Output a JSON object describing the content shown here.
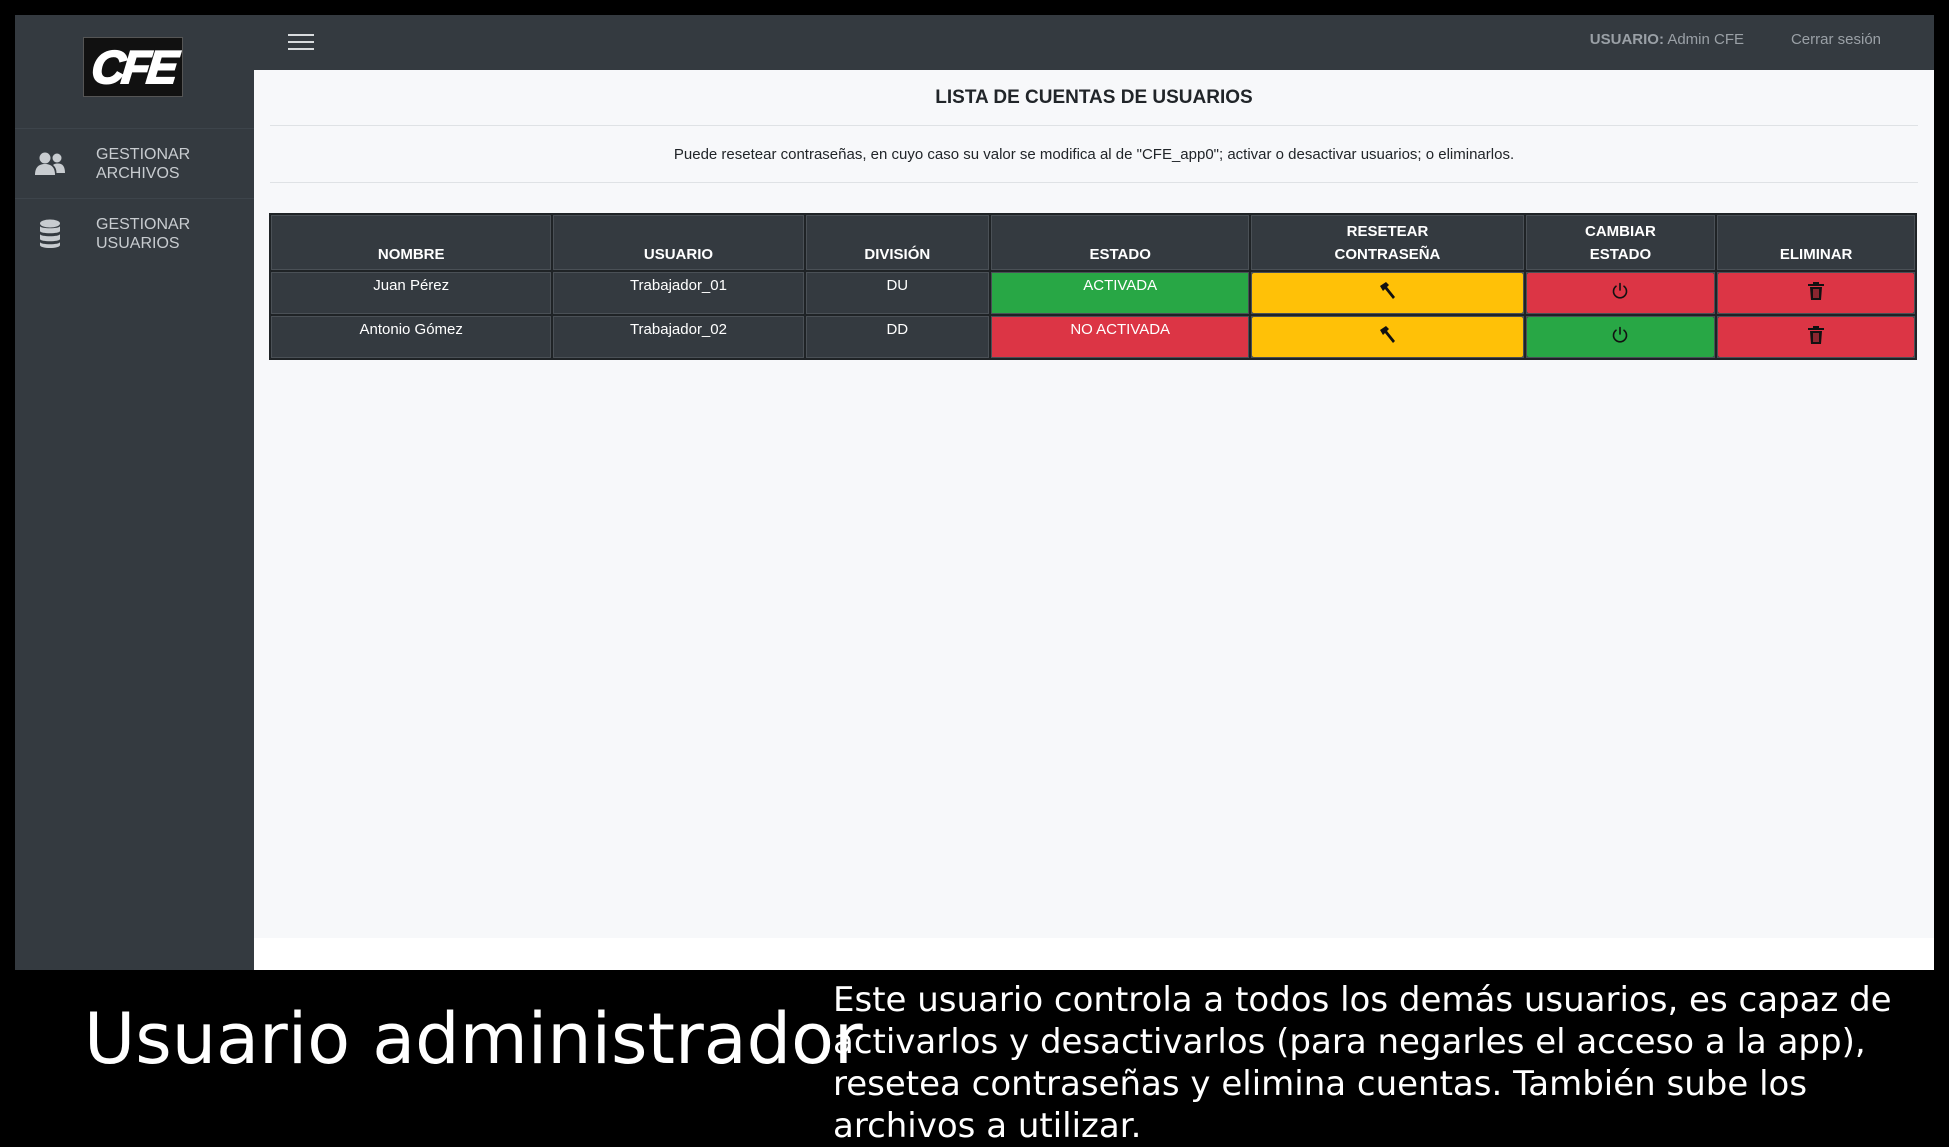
{
  "app": {
    "logo_text": "CFE",
    "user_label": "USUARIO:",
    "user_name": "Admin CFE",
    "logout_label": "Cerrar sesión"
  },
  "sidebar": {
    "items": [
      {
        "label": "GESTIONAR\nARCHIVOS",
        "icon": "users-icon"
      },
      {
        "label": "GESTIONAR\nUSUARIOS",
        "icon": "database-icon"
      }
    ]
  },
  "main": {
    "title": "LISTA DE CUENTAS DE USUARIOS",
    "description": "Puede resetear contraseñas, en cuyo caso su valor se modifica al de \"CFE_app0\"; activar o desactivar usuarios; o eliminarlos.",
    "table": {
      "headers": [
        "NOMBRE",
        "USUARIO",
        "DIVISIÓN",
        "ESTADO",
        "RESETEAR\nCONTRASEÑA",
        "CAMBIAR\nESTADO",
        "ELIMINAR"
      ],
      "rows": [
        {
          "nombre": "Juan Pérez",
          "usuario": "Trabajador_01",
          "division": "DU",
          "estado": "ACTIVADA",
          "estado_color": "#28a745",
          "reset_icon": "hammer-icon",
          "toggle_icon": "power-icon",
          "toggle_color": "#dc3545",
          "delete_icon": "trash-icon"
        },
        {
          "nombre": "Antonio Gómez",
          "usuario": "Trabajador_02",
          "division": "DD",
          "estado": "NO ACTIVADA",
          "estado_color": "#dc3545",
          "reset_icon": "hammer-icon",
          "toggle_icon": "power-icon",
          "toggle_color": "#28a745",
          "delete_icon": "trash-icon"
        }
      ]
    }
  },
  "caption": {
    "title": "Usuario administrador",
    "text": "Este usuario controla a todos los demás usuarios, es capaz de activarlos y desactivarlos (para negarles el acceso a la app), resetea contraseñas y elimina cuentas. También sube los archivos a utilizar."
  },
  "colors": {
    "sidebar_bg": "#343a40",
    "warning": "#ffc107",
    "danger": "#dc3545",
    "success": "#28a745"
  }
}
